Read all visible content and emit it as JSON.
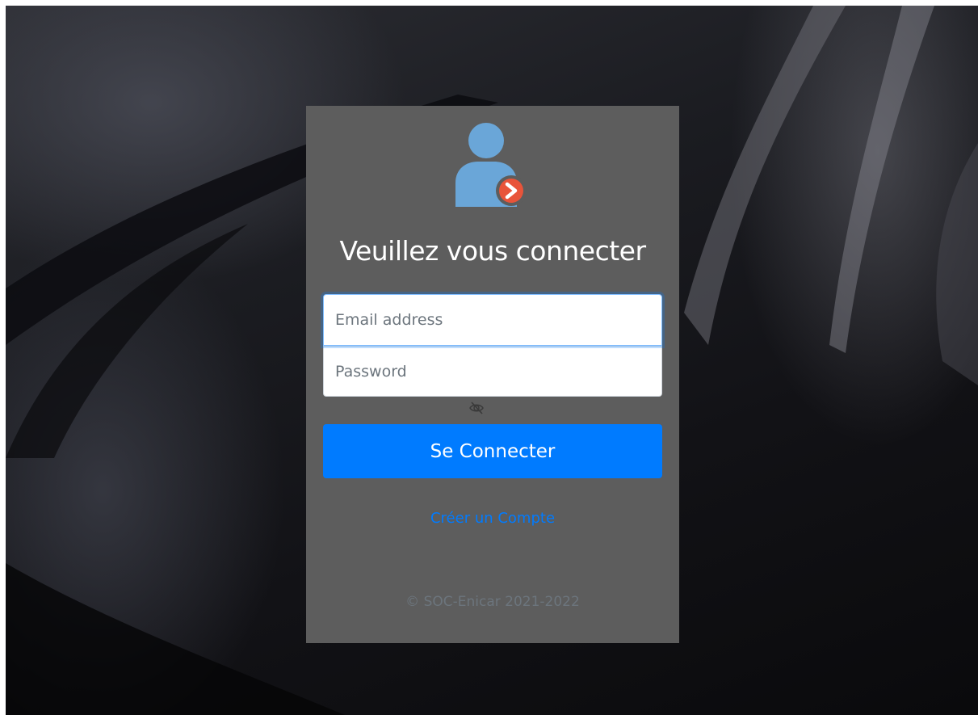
{
  "login": {
    "title": "Veuillez vous connecter",
    "email_placeholder": "Email address",
    "password_placeholder": "Password",
    "submit_label": "Se Connecter",
    "create_account_label": "Créer un Compte",
    "footer_text": "© SOC-Enicar 2021-2022"
  },
  "icons": {
    "user": "user-login-icon",
    "password_toggle": "eye-slash-icon"
  },
  "colors": {
    "primary": "#007bff",
    "card_background": "#5d5d5d",
    "user_icon": "#6aa6d8",
    "badge": "#e8543a"
  }
}
